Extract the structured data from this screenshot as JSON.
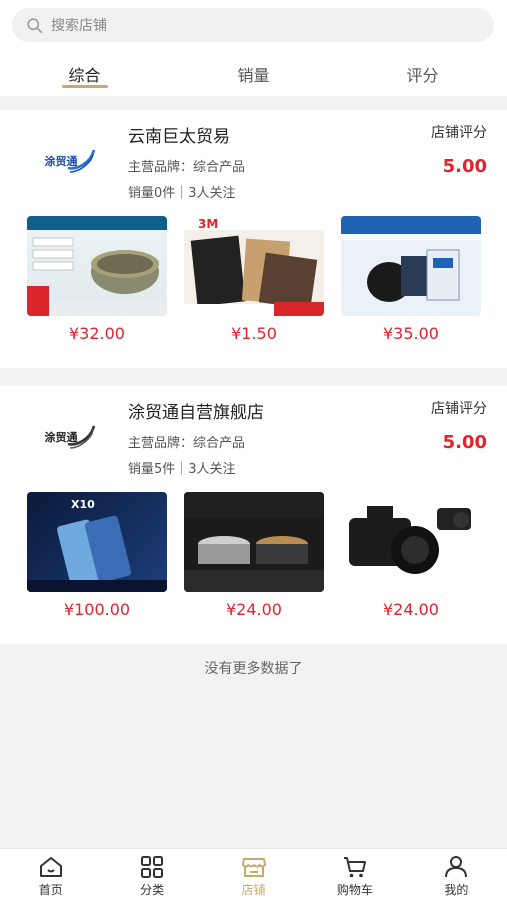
{
  "search": {
    "placeholder": "搜索店铺"
  },
  "tabs": [
    {
      "label": "综合",
      "active": true
    },
    {
      "label": "销量"
    },
    {
      "label": "评分"
    }
  ],
  "stores": [
    {
      "logo_text": "涂贸通",
      "name": "云南巨太贸易",
      "brand": "主营品牌：综合产品",
      "sales": "销量0件｜3人关注",
      "rating_label": "店铺评分",
      "rating": "5.00",
      "products": [
        {
          "price": "¥32.00",
          "image": "tin-can-product"
        },
        {
          "price": "¥1.50",
          "image": "3m-sandpaper-product"
        },
        {
          "price": "¥35.00",
          "image": "toner-powder-product"
        }
      ]
    },
    {
      "logo_text": "涂贸通",
      "name": "涂贸通自营旗舰店",
      "brand": "主营品牌：综合产品",
      "sales": "销量5件｜3人关注",
      "rating_label": "店铺评分",
      "rating": "5.00",
      "products": [
        {
          "price": "¥100.00",
          "image": "honor-x10-phone"
        },
        {
          "price": "¥24.00",
          "image": "double-pot-cookware"
        },
        {
          "price": "¥24.00",
          "image": "pentax-camera"
        }
      ]
    }
  ],
  "footer_note": "没有更多数据了",
  "tabbar": [
    {
      "label": "首页",
      "icon": "home-icon"
    },
    {
      "label": "分类",
      "icon": "category-icon"
    },
    {
      "label": "店铺",
      "icon": "store-icon",
      "active": true
    },
    {
      "label": "购物车",
      "icon": "cart-icon"
    },
    {
      "label": "我的",
      "icon": "user-icon"
    }
  ],
  "colors": {
    "accent": "#c9a96a",
    "price": "#e0252f"
  }
}
